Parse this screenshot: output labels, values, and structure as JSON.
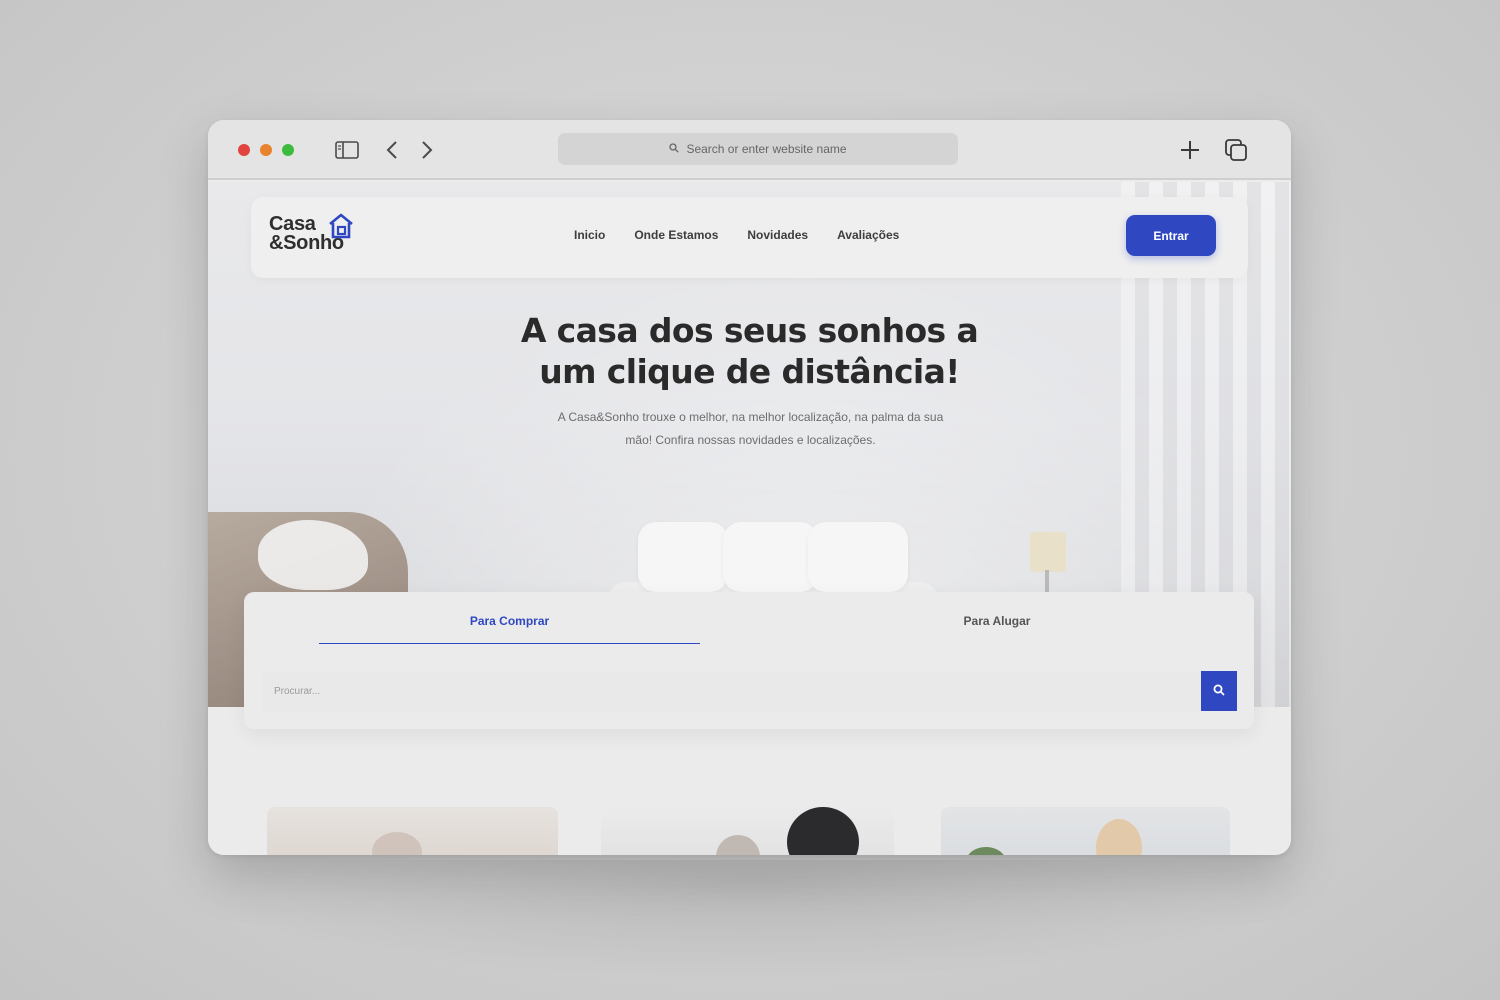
{
  "browser": {
    "address_placeholder": "Search or enter website name",
    "icons": [
      "sidebar-icon",
      "back-icon",
      "forward-icon",
      "search-icon",
      "new-tab-icon",
      "tabs-overview-icon"
    ]
  },
  "site": {
    "logo_line1": "Casa",
    "logo_line2": "&Sonho",
    "nav": [
      "Inicio",
      "Onde Estamos",
      "Novidades",
      "Avaliações"
    ],
    "login_label": "Entrar",
    "accent_color": "#2f48c2"
  },
  "hero": {
    "headline_line1": "A casa dos seus sonhos a",
    "headline_line2": "um clique de distância!",
    "subtext_line1": "A Casa&Sonho trouxe o melhor, na melhor localização, na palma da sua",
    "subtext_line2": "mão! Confira nossas novidades e localizações."
  },
  "search": {
    "tabs": [
      "Para Comprar",
      "Para Alugar"
    ],
    "active_tab": "Para Comprar",
    "placeholder": "Procurar..."
  }
}
